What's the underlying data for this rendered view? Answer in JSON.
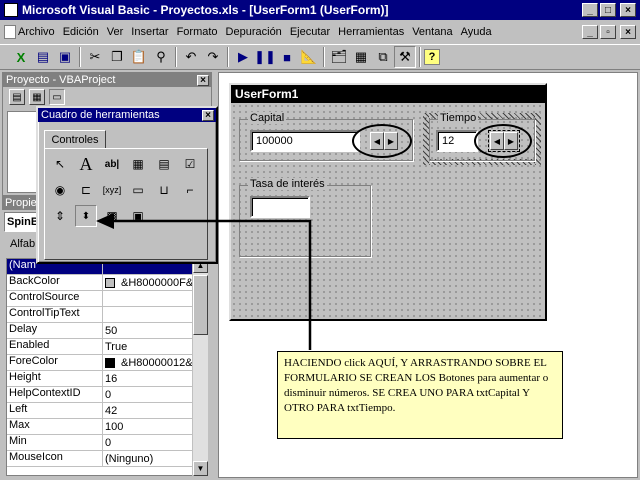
{
  "title": "Microsoft Visual Basic - Proyectos.xls - [UserForm1 (UserForm)]",
  "window_buttons": [
    "_",
    "□",
    "×"
  ],
  "menu": [
    "Archivo",
    "Edición",
    "Ver",
    "Insertar",
    "Formato",
    "Depuración",
    "Ejecutar",
    "Herramientas",
    "Ventana",
    "Ayuda"
  ],
  "mdi_buttons": [
    "_",
    "▫",
    "×"
  ],
  "project_pane": {
    "title": "Proyecto - VBAProject",
    "close": "×"
  },
  "toolbox": {
    "title": "Cuadro de herramientas",
    "close": "×",
    "tab": "Controles"
  },
  "properties_pane": {
    "title": "Propie",
    "object": "SpinB",
    "tab": "Alfab",
    "selected": "(Nam",
    "rows": [
      {
        "name": "BackColor",
        "value": "&H8000000F&",
        "swatch": "#c0c0c0"
      },
      {
        "name": "ControlSource",
        "value": ""
      },
      {
        "name": "ControlTipText",
        "value": ""
      },
      {
        "name": "Delay",
        "value": "50"
      },
      {
        "name": "Enabled",
        "value": "True"
      },
      {
        "name": "ForeColor",
        "value": "&H80000012&",
        "swatch": "#000000"
      },
      {
        "name": "Height",
        "value": "16"
      },
      {
        "name": "HelpContextID",
        "value": "0"
      },
      {
        "name": "Left",
        "value": "42"
      },
      {
        "name": "Max",
        "value": "100"
      },
      {
        "name": "Min",
        "value": "0"
      },
      {
        "name": "MouseIcon",
        "value": "(Ninguno)"
      }
    ]
  },
  "userform": {
    "title": "UserForm1",
    "capital": {
      "label": "Capital",
      "value": "100000"
    },
    "tiempo": {
      "label": "Tiempo",
      "value": "12"
    },
    "tasa": {
      "label": "Tasa de interés",
      "value": ""
    }
  },
  "note": "HACIENDO click AQUÍ, Y ARRASTRANDO SOBRE EL FORMULARIO SE CREAN LOS Botones para aumentar o disminuir números. SE CREA UNO PARA txtCapital Y OTRO PARA txtTiempo.",
  "colors": {
    "title_active": "#000080",
    "title_inactive": "#808080",
    "note_bg": "#ffffc0",
    "face": "#c0c0c0"
  }
}
